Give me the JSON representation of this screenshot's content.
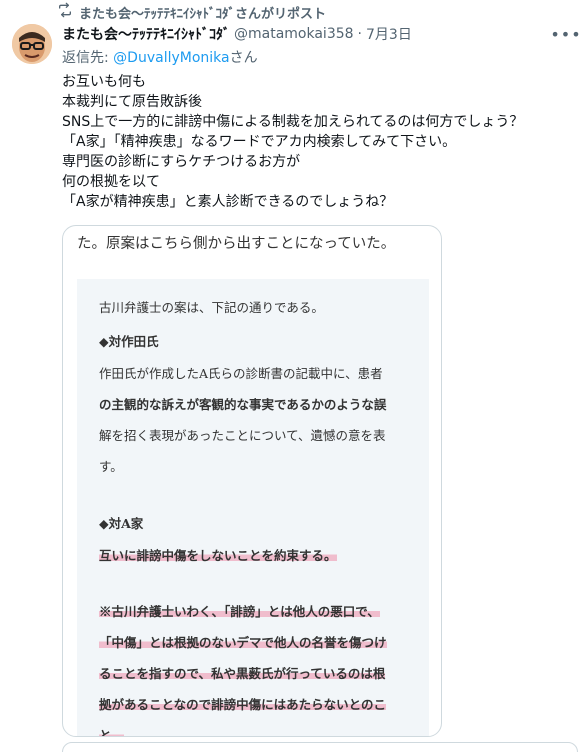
{
  "repost": {
    "icon": "repost-icon",
    "label": "またも会〜ﾃｯﾃﾃｷﾆｲｼｬﾄﾞｺﾀﾞさんがリポスト"
  },
  "post": {
    "avatar": "avatar",
    "display_name": "またも会〜ﾃｯﾃﾃｷﾆｲｼｬﾄﾞｺﾀﾞ",
    "handle": "@matamokai358",
    "separator": "·",
    "date": "7月3日",
    "more_icon": "more-icon",
    "reply_prefix": "返信先: ",
    "reply_mention": "@DuvallyMonika",
    "reply_suffix": "さん",
    "text_lines": [
      "お互いも何も",
      "本裁判にて原告敗訴後",
      "SNS上で一方的に誹謗中傷による制裁を加えられてるのは何方でしょう？",
      "「A家」「精神疾患」なるワードでアカ内検索してみて下さい。",
      "専門医の診断にすらケチつけるお方が",
      "何の根拠を以て",
      "「A家が精神疾患」と素人診断できるのでしょうね？"
    ]
  },
  "media": {
    "top_line": "た。原案はこちら側から出すことになっていた。",
    "quote_lines": [
      "古川弁護士の案は、下記の通りである。",
      "◆対作田氏",
      "作田氏が作成したA氏らの診断書の記載中に、患者",
      "の主観的な訴えが客観的な事実であるかのような誤",
      "解を招く表現があったことについて、遺憾の意を表",
      "す。",
      "◆対A家",
      "互いに誹謗中傷をしないことを約束する。",
      "※古川弁護士いわく、「誹謗」とは他人の悪口で、",
      "「中傷」とは根拠のないデマで他人の名誉を傷つけ",
      "ることを指すので、私や黒薮氏が行っているのは根",
      "拠があることなので誹謗中傷にはあたらないとのこ",
      "と。"
    ]
  }
}
